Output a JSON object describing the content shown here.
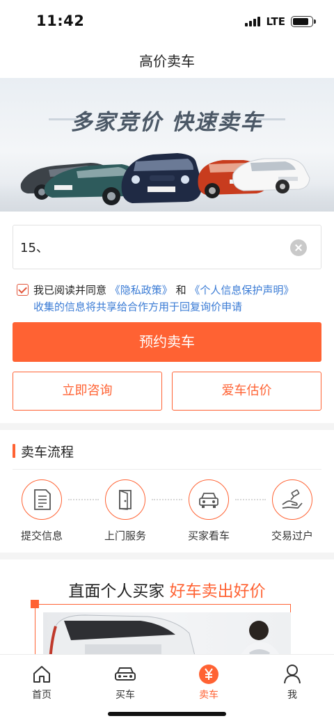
{
  "status_bar": {
    "time": "11:42",
    "network": "LTE",
    "battery_level": 0.85
  },
  "nav": {
    "title": "高价卖车"
  },
  "banner": {
    "headline": "多家竞价 快速卖车"
  },
  "form": {
    "phone_value": "15、",
    "agreement": {
      "prefix": "我已阅读并同意",
      "privacy_link": "《隐私政策》",
      "conjunction": "和",
      "personal_info_link": "《个人信息保护声明》",
      "line2": "收集的信息将共享给合作方用于回复询价申请",
      "checked": true
    },
    "primary_button": "预约卖车",
    "consult_button": "立即咨询",
    "estimate_button": "爱车估价"
  },
  "process": {
    "heading": "卖车流程",
    "steps": [
      {
        "label": "提交信息",
        "icon": "document-icon"
      },
      {
        "label": "上门服务",
        "icon": "door-icon"
      },
      {
        "label": "买家看车",
        "icon": "car-front-icon"
      },
      {
        "label": "交易过户",
        "icon": "handshake-key-icon"
      }
    ]
  },
  "promo": {
    "title_plain": "直面个人买家",
    "title_highlight": "好车卖出好价"
  },
  "tab_bar": {
    "tabs": [
      {
        "label": "首页",
        "icon": "home-icon",
        "active": false
      },
      {
        "label": "买车",
        "icon": "car-icon",
        "active": false
      },
      {
        "label": "卖车",
        "icon": "yen-icon",
        "active": true
      },
      {
        "label": "我",
        "icon": "user-icon",
        "active": false
      }
    ]
  },
  "colors": {
    "accent": "#ff6233",
    "link": "#3a7bd5"
  }
}
